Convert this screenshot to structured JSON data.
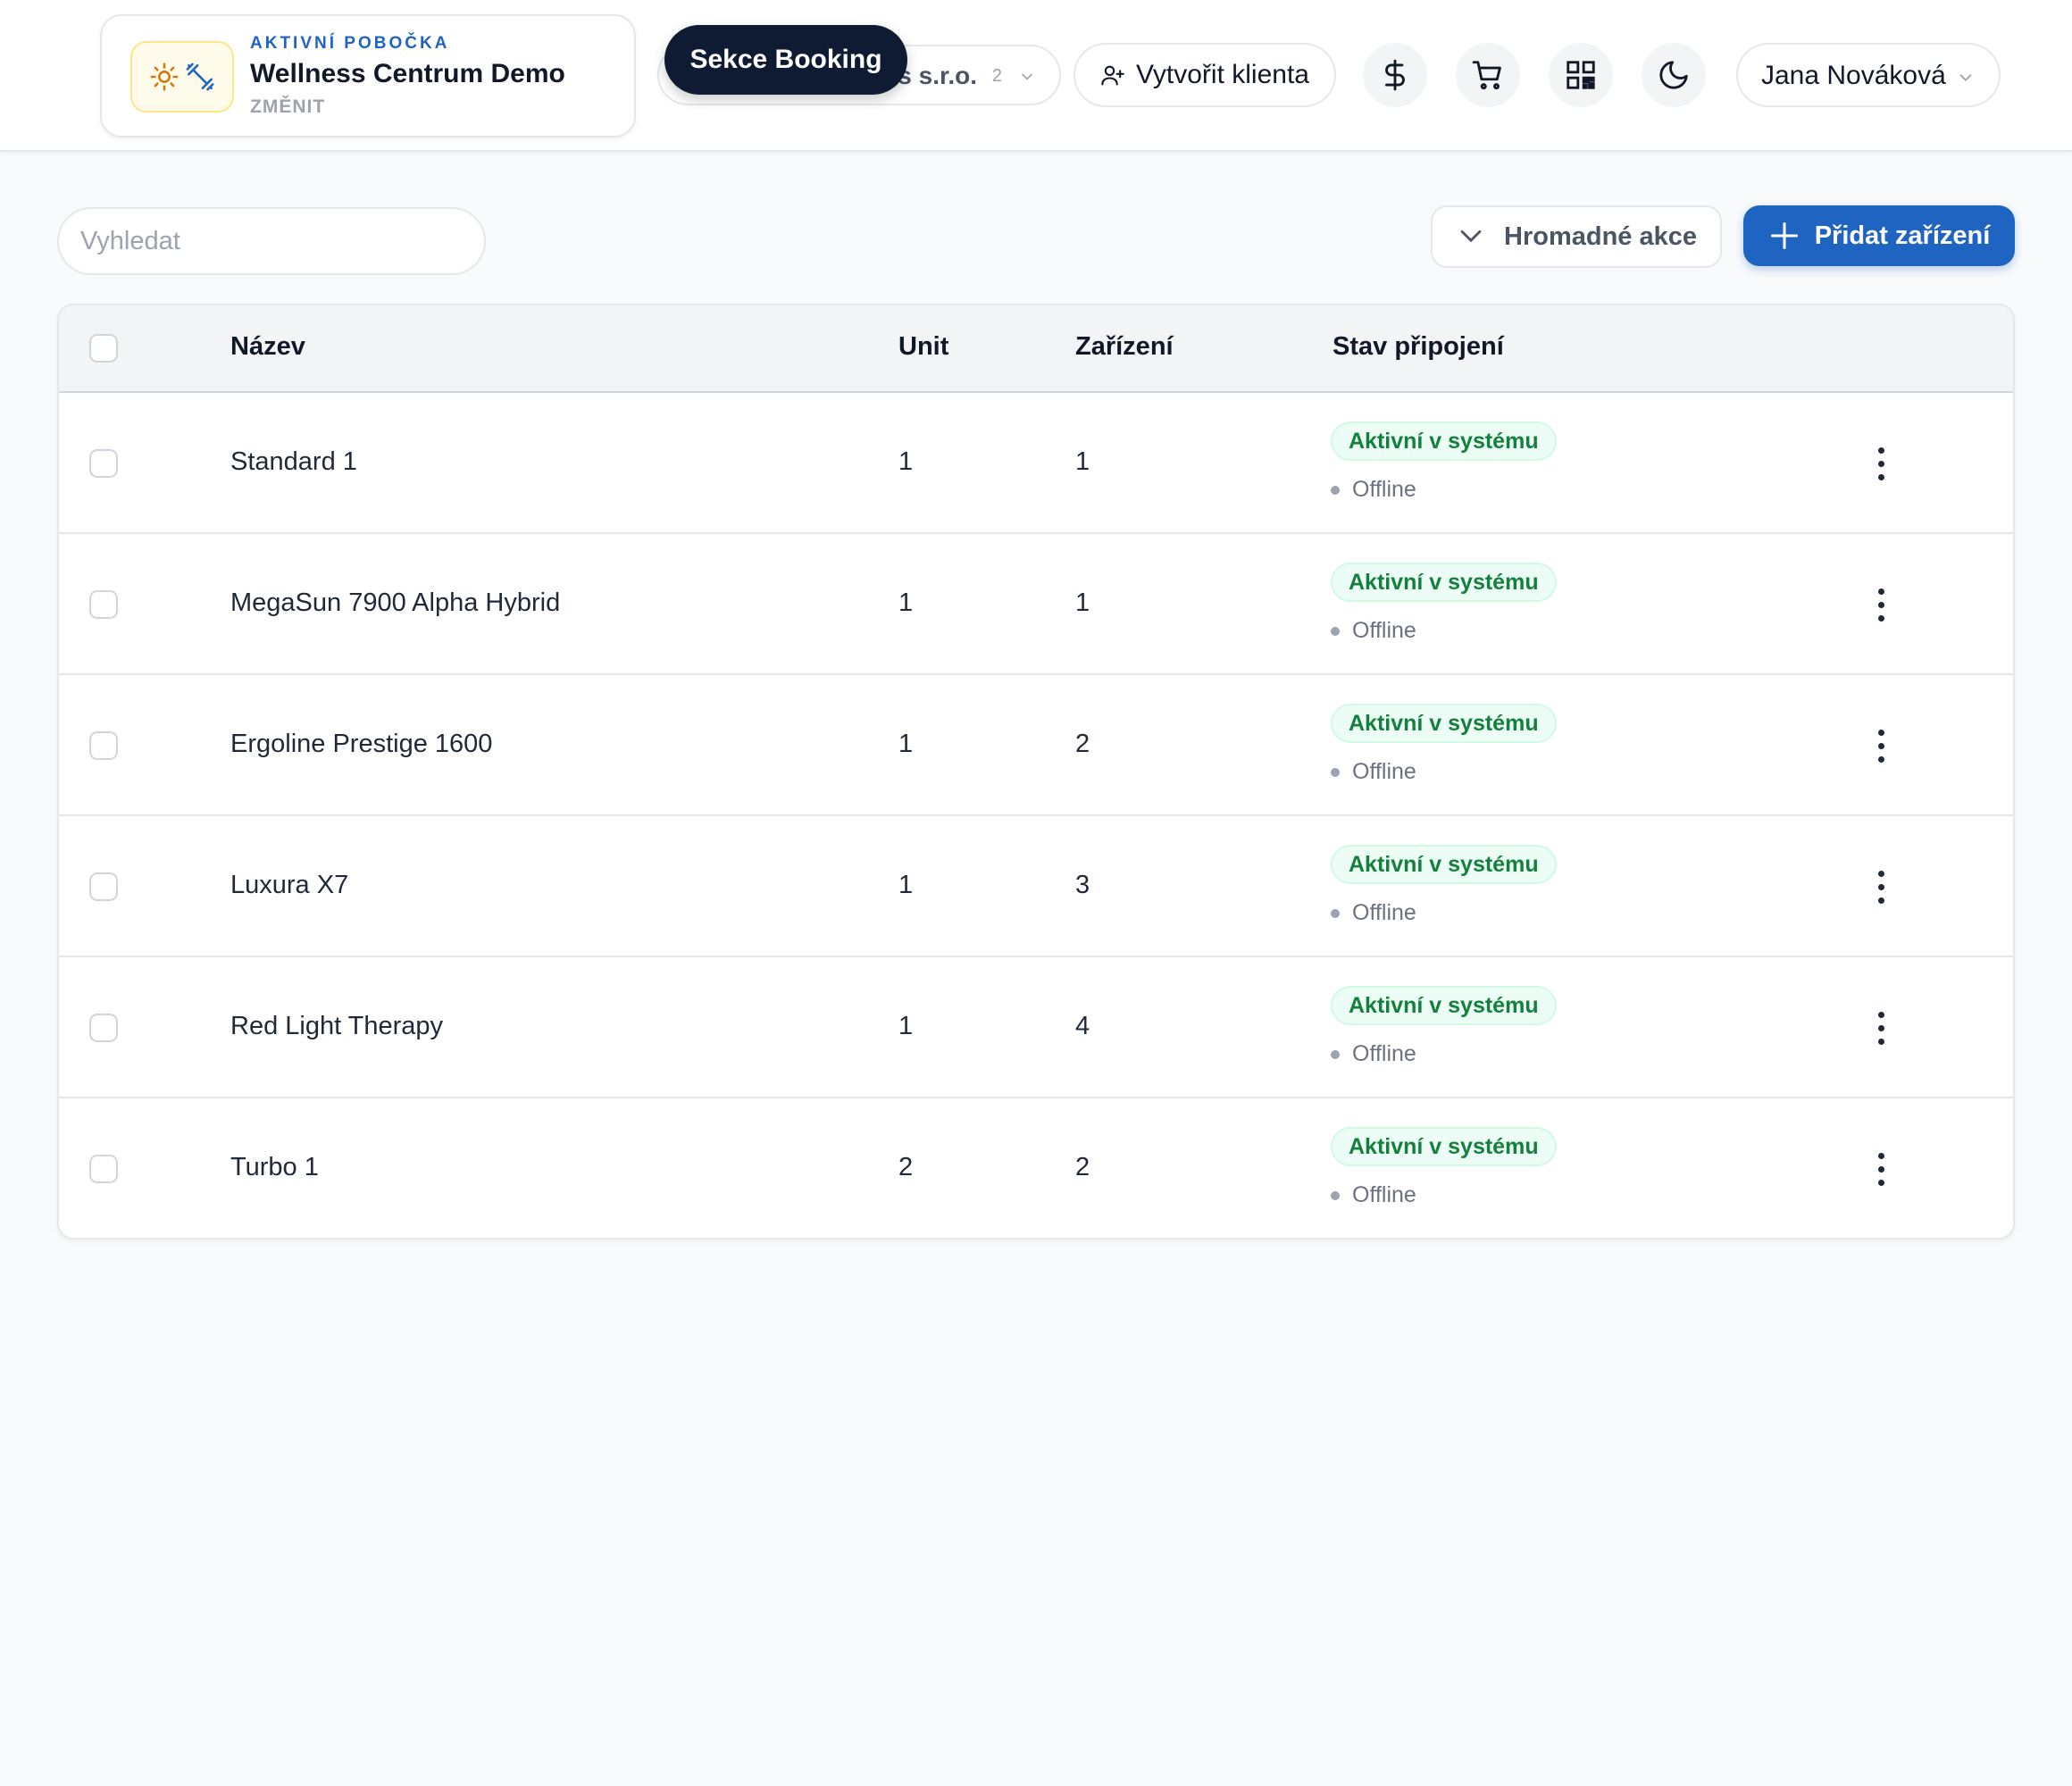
{
  "header": {
    "branch": {
      "eyebrow": "AKTIVNÍ POBOČKA",
      "name": "Wellness Centrum Demo",
      "change_label": "ZMĚNIT"
    },
    "company": {
      "name": "s s.r.o.",
      "count": "2"
    },
    "tooltip": "Sekce Booking",
    "create_client_label": "Vytvořit klienta",
    "user_name": "Jana Nováková"
  },
  "toolbar": {
    "search_placeholder": "Vyhledat",
    "bulk_actions_label": "Hromadné akce",
    "add_device_label": "Přidat zařízení"
  },
  "table": {
    "columns": {
      "name": "Název",
      "unit": "Unit",
      "devices": "Zařízení",
      "connection": "Stav připojení"
    },
    "rows": [
      {
        "name": "Standard 1",
        "unit": "1",
        "devices": "1",
        "badge": "Aktivní v systému",
        "status": "Offline"
      },
      {
        "name": "MegaSun 7900 Alpha Hybrid",
        "unit": "1",
        "devices": "1",
        "badge": "Aktivní v systému",
        "status": "Offline"
      },
      {
        "name": "Ergoline Prestige 1600",
        "unit": "1",
        "devices": "2",
        "badge": "Aktivní v systému",
        "status": "Offline"
      },
      {
        "name": "Luxura X7",
        "unit": "1",
        "devices": "3",
        "badge": "Aktivní v systému",
        "status": "Offline"
      },
      {
        "name": "Red Light Therapy",
        "unit": "1",
        "devices": "4",
        "badge": "Aktivní v systému",
        "status": "Offline"
      },
      {
        "name": "Turbo 1",
        "unit": "2",
        "devices": "2",
        "badge": "Aktivní v systému",
        "status": "Offline"
      }
    ]
  },
  "colors": {
    "primary": "#1f64c0",
    "tooltip_bg": "#0f1b33",
    "badge_green": "#15803d",
    "badge_bg": "#ecfdf5"
  },
  "icons": {
    "branch_logo": [
      "sun-icon",
      "dumbbell-icon"
    ],
    "create_client": "user-plus-icon",
    "actions": [
      "dollar-icon",
      "cart-icon",
      "qr-code-icon",
      "moon-icon"
    ],
    "user_menu": "chevron-down-icon",
    "bulk_actions": "chevron-down-icon",
    "add_device": "plus-icon",
    "row_menu": "more-vertical-icon"
  }
}
